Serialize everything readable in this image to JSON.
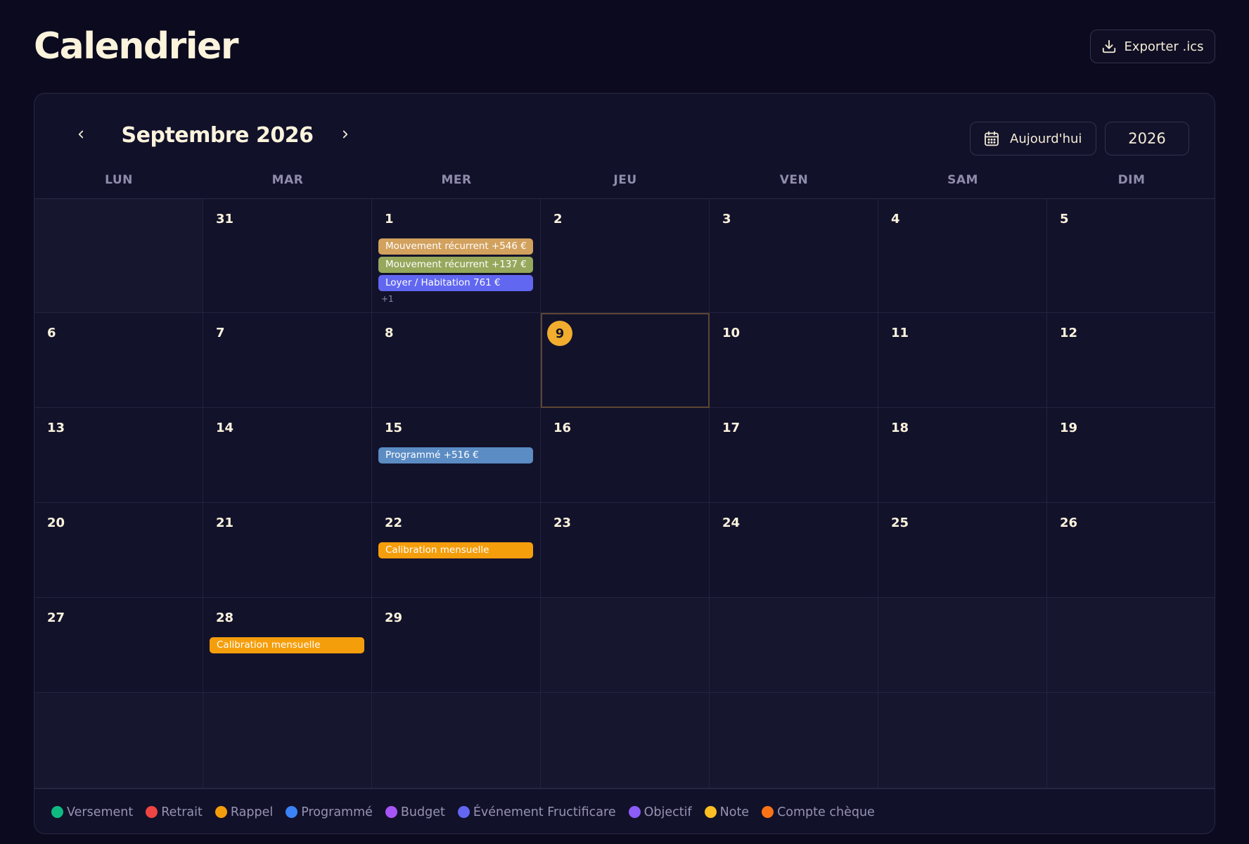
{
  "header": {
    "title": "Calendrier",
    "export_label": "Exporter .ics"
  },
  "toolbar": {
    "month_label": "Septembre 2026",
    "today_label": "Aujourd'hui",
    "year": "2026"
  },
  "weekdays": [
    "LUN",
    "MAR",
    "MER",
    "JEU",
    "VEN",
    "SAM",
    "DIM"
  ],
  "weeks": [
    [
      {
        "day": "",
        "outside": true
      },
      {
        "day": "31",
        "outside": false
      },
      {
        "day": "1",
        "outside": false,
        "events": [
          {
            "label": "Mouvement récurrent +546 €",
            "color": "#d2a15e"
          },
          {
            "label": "Mouvement récurrent +137 €",
            "color": "#96a85c"
          },
          {
            "label": "Loyer / Habitation 761 €",
            "color": "#6167f0"
          }
        ],
        "more": "+1"
      },
      {
        "day": "2",
        "outside": false
      },
      {
        "day": "3",
        "outside": false
      },
      {
        "day": "4",
        "outside": false
      },
      {
        "day": "5",
        "outside": false
      }
    ],
    [
      {
        "day": "6",
        "outside": false
      },
      {
        "day": "7",
        "outside": false
      },
      {
        "day": "8",
        "outside": false
      },
      {
        "day": "9",
        "outside": false,
        "today": true
      },
      {
        "day": "10",
        "outside": false
      },
      {
        "day": "11",
        "outside": false
      },
      {
        "day": "12",
        "outside": false
      }
    ],
    [
      {
        "day": "13",
        "outside": false
      },
      {
        "day": "14",
        "outside": false
      },
      {
        "day": "15",
        "outside": false,
        "events": [
          {
            "label": "Programmé +516 €",
            "color": "#5b8cc4"
          }
        ]
      },
      {
        "day": "16",
        "outside": false
      },
      {
        "day": "17",
        "outside": false
      },
      {
        "day": "18",
        "outside": false
      },
      {
        "day": "19",
        "outside": false
      }
    ],
    [
      {
        "day": "20",
        "outside": false
      },
      {
        "day": "21",
        "outside": false
      },
      {
        "day": "22",
        "outside": false,
        "events": [
          {
            "label": "Calibration mensuelle",
            "color": "#f59e0b"
          }
        ]
      },
      {
        "day": "23",
        "outside": false
      },
      {
        "day": "24",
        "outside": false
      },
      {
        "day": "25",
        "outside": false
      },
      {
        "day": "26",
        "outside": false
      }
    ],
    [
      {
        "day": "27",
        "outside": false
      },
      {
        "day": "28",
        "outside": false,
        "events": [
          {
            "label": "Calibration mensuelle",
            "color": "#f59e0b"
          }
        ]
      },
      {
        "day": "29",
        "outside": false
      },
      {
        "day": "",
        "outside": true
      },
      {
        "day": "",
        "outside": true
      },
      {
        "day": "",
        "outside": true
      },
      {
        "day": "",
        "outside": true
      }
    ],
    [
      {
        "day": "",
        "outside": true
      },
      {
        "day": "",
        "outside": true
      },
      {
        "day": "",
        "outside": true
      },
      {
        "day": "",
        "outside": true
      },
      {
        "day": "",
        "outside": true
      },
      {
        "day": "",
        "outside": true
      },
      {
        "day": "",
        "outside": true
      }
    ]
  ],
  "legend": [
    {
      "label": "Versement",
      "color": "#10b981"
    },
    {
      "label": "Retrait",
      "color": "#ef4444"
    },
    {
      "label": "Rappel",
      "color": "#f59e0b"
    },
    {
      "label": "Programmé",
      "color": "#3b82f6"
    },
    {
      "label": "Budget",
      "color": "#a855f7"
    },
    {
      "label": "Événement Fructificare",
      "color": "#6366f1"
    },
    {
      "label": "Objectif",
      "color": "#8b5cf6"
    },
    {
      "label": "Note",
      "color": "#fbbf24"
    },
    {
      "label": "Compte chèque",
      "color": "#f97316"
    }
  ],
  "icons": {
    "export": "download-icon",
    "today": "calendar-icon",
    "prev": "chevron-left-icon",
    "next": "chevron-right-icon"
  }
}
